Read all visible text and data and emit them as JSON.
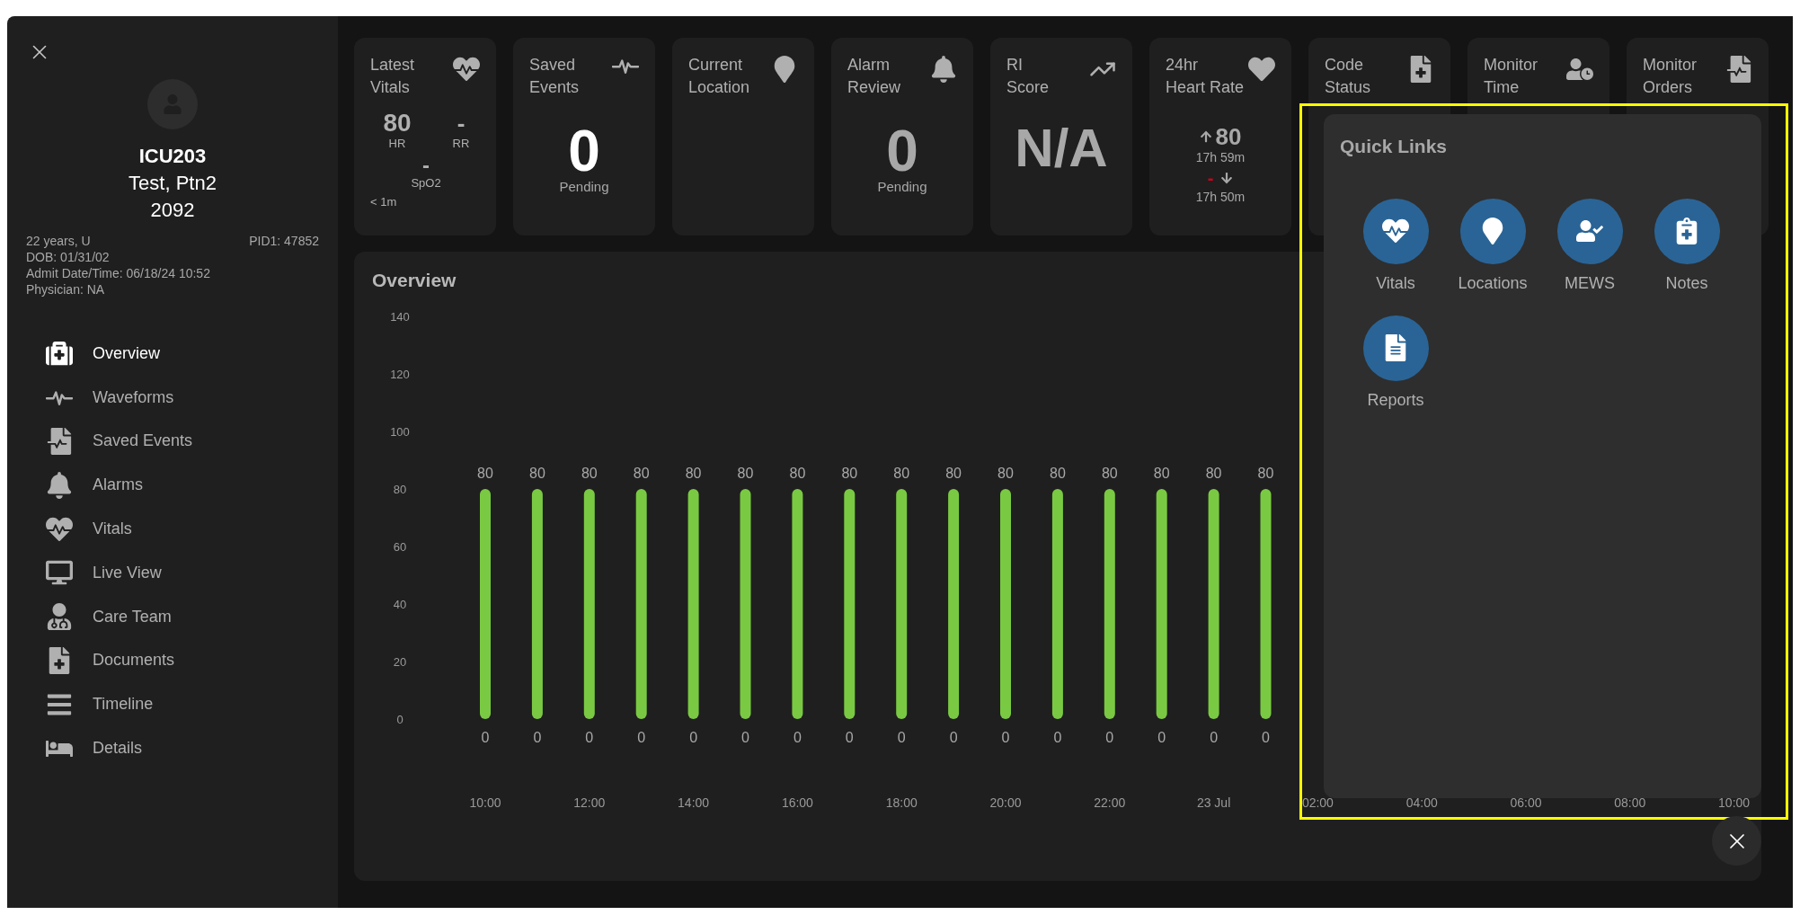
{
  "sidebar": {
    "unit": "ICU203",
    "patient_name": "Test, Ptn2",
    "bed": "2092",
    "age_sex": "22 years, U",
    "pid": "PID1: 47852",
    "dob": "DOB: 01/31/02",
    "admit": "Admit Date/Time: 06/18/24 10:52",
    "physician": "Physician: NA",
    "nav": [
      {
        "label": "Overview",
        "selected": true
      },
      {
        "label": "Waveforms",
        "selected": false
      },
      {
        "label": "Saved Events",
        "selected": false
      },
      {
        "label": "Alarms",
        "selected": false
      },
      {
        "label": "Vitals",
        "selected": false
      },
      {
        "label": "Live View",
        "selected": false
      },
      {
        "label": "Care Team",
        "selected": false
      },
      {
        "label": "Documents",
        "selected": false
      },
      {
        "label": "Timeline",
        "selected": false
      },
      {
        "label": "Details",
        "selected": false
      }
    ]
  },
  "cards": [
    {
      "kind": "vitals",
      "title": [
        "Latest",
        "Vitals"
      ],
      "hr": "80",
      "hr_label": "HR",
      "rr": "-",
      "rr_label": "RR",
      "spo2": "-",
      "spo2_label": "SpO2",
      "age": "< 1m"
    },
    {
      "kind": "count",
      "title": [
        "Saved",
        "Events"
      ],
      "count": "0",
      "bright": true,
      "caption": "Pending"
    },
    {
      "kind": "empty",
      "title": [
        "Current",
        "Location"
      ]
    },
    {
      "kind": "count",
      "title": [
        "Alarm",
        "Review"
      ],
      "count": "0",
      "bright": false,
      "caption": "Pending"
    },
    {
      "kind": "score",
      "title": [
        "RI",
        "Score"
      ],
      "value": "N/A"
    },
    {
      "kind": "heart_rate",
      "title": [
        "24hr",
        "Heart Rate"
      ],
      "high": "80",
      "high_time": "17h 59m",
      "low": "-",
      "low_time": "17h 50m"
    },
    {
      "kind": "empty",
      "title": [
        "Code",
        "Status"
      ]
    },
    {
      "kind": "empty",
      "title": [
        "Monitor",
        "Time"
      ]
    },
    {
      "kind": "empty",
      "title": [
        "Monitor",
        "Orders"
      ]
    }
  ],
  "overview": {
    "title": "Overview",
    "base_labels": [
      "0",
      "0",
      "0",
      "0",
      "0",
      "0",
      "0",
      "0",
      "0",
      "0",
      "0",
      "0",
      "0",
      "0",
      "0",
      "0"
    ],
    "chart_data": {
      "type": "bar",
      "categories": [
        "10:00",
        null,
        "12:00",
        null,
        "14:00",
        null,
        "16:00",
        null,
        "18:00",
        null,
        "20:00",
        null,
        "22:00",
        null,
        "23 Jul",
        null,
        "02:00",
        null,
        "04:00",
        null,
        "06:00",
        null,
        "08:00",
        null,
        "10:00"
      ],
      "series": [
        {
          "color": "#7ac943",
          "values": [
            80,
            80,
            80,
            80,
            80,
            80,
            80,
            80,
            80,
            80,
            80,
            80,
            80,
            80,
            80,
            80,
            null,
            null,
            null,
            null,
            null,
            null,
            null,
            null,
            null
          ]
        }
      ],
      "ylim": [
        0,
        140
      ],
      "yticks": [
        0,
        20,
        40,
        60,
        80,
        100,
        120,
        140
      ],
      "value_labels": [
        "80",
        "80",
        "80",
        "80",
        "80",
        "80",
        "80",
        "80",
        "80",
        "80",
        "80",
        "80",
        "80",
        "80",
        "80",
        "80",
        null,
        null,
        null,
        null,
        null,
        null,
        null,
        null,
        null
      ]
    }
  },
  "quick_links": {
    "title": "Quick Links",
    "items": [
      {
        "label": "Vitals"
      },
      {
        "label": "Locations"
      },
      {
        "label": "MEWS"
      },
      {
        "label": "Notes"
      },
      {
        "label": "Reports"
      }
    ]
  }
}
